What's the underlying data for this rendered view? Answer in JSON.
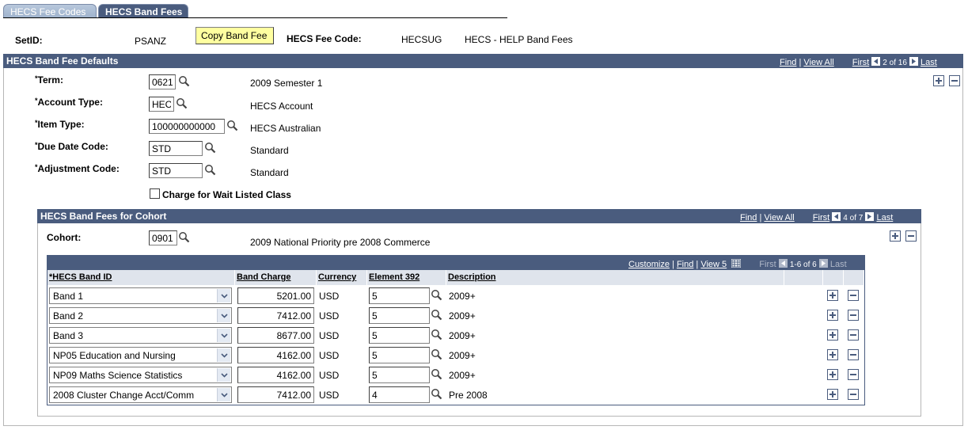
{
  "tabs": [
    {
      "label": "HECS Fee Codes",
      "active": false
    },
    {
      "label": "HECS Band Fees",
      "active": true
    }
  ],
  "header": {
    "setid_label": "SetID:",
    "setid_value": "PSANZ",
    "copy_button": "Copy Band Fee",
    "fee_code_label": "HECS Fee Code:",
    "fee_code_value": "HECSUG",
    "fee_code_desc": "HECS - HELP Band Fees"
  },
  "defaults": {
    "title": "HECS Band Fee Defaults",
    "nav": {
      "find": "Find",
      "view_all": "View All",
      "first": "First",
      "position": "2 of 16",
      "last": "Last"
    },
    "fields": [
      {
        "label": "Term:",
        "value": "0621",
        "desc": "2009 Semester 1"
      },
      {
        "label": "Account Type:",
        "value": "HEC",
        "desc": "HECS Account"
      },
      {
        "label": "Item Type:",
        "value": "100000000000",
        "desc": "HECS Australian"
      },
      {
        "label": "Due Date Code:",
        "value": "STD",
        "desc": "Standard"
      },
      {
        "label": "Adjustment Code:",
        "value": "STD",
        "desc": "Standard"
      }
    ],
    "required_marker": "*",
    "checkbox_label": "Charge for Wait Listed Class",
    "checkbox_checked": false
  },
  "cohort": {
    "title": "HECS Band Fees for Cohort",
    "nav": {
      "find": "Find",
      "view_all": "View All",
      "first": "First",
      "position": "4 of 7",
      "last": "Last"
    },
    "label": "Cohort:",
    "value": "0901",
    "desc": "2009 National Priority pre 2008 Commerce"
  },
  "grid": {
    "nav": {
      "customize": "Customize",
      "find": "Find",
      "view": "View 5",
      "first": "First",
      "position": "1-6 of 6",
      "last": "Last"
    },
    "columns": [
      "*HECS Band ID",
      "Band Charge",
      "Currency",
      "Element 392",
      "Description"
    ],
    "rows": [
      {
        "band": "Band 1",
        "charge": "5201.00",
        "currency": "USD",
        "element": "5",
        "desc": "2009+"
      },
      {
        "band": "Band 2",
        "charge": "7412.00",
        "currency": "USD",
        "element": "5",
        "desc": "2009+"
      },
      {
        "band": "Band 3",
        "charge": "8677.00",
        "currency": "USD",
        "element": "5",
        "desc": "2009+"
      },
      {
        "band": "NP05 Education and Nursing",
        "charge": "4162.00",
        "currency": "USD",
        "element": "5",
        "desc": "2009+"
      },
      {
        "band": "NP09 Maths Science Statistics",
        "charge": "4162.00",
        "currency": "USD",
        "element": "5",
        "desc": "2009+"
      },
      {
        "band": "2008 Cluster Change Acct/Comm",
        "charge": "7412.00",
        "currency": "USD",
        "element": "4",
        "desc": "Pre 2008"
      }
    ]
  },
  "colors": {
    "header_bg": "#4a5c7e",
    "button_yellow": "#ffffa0",
    "grid_header_bg": "#dfe4ec"
  }
}
